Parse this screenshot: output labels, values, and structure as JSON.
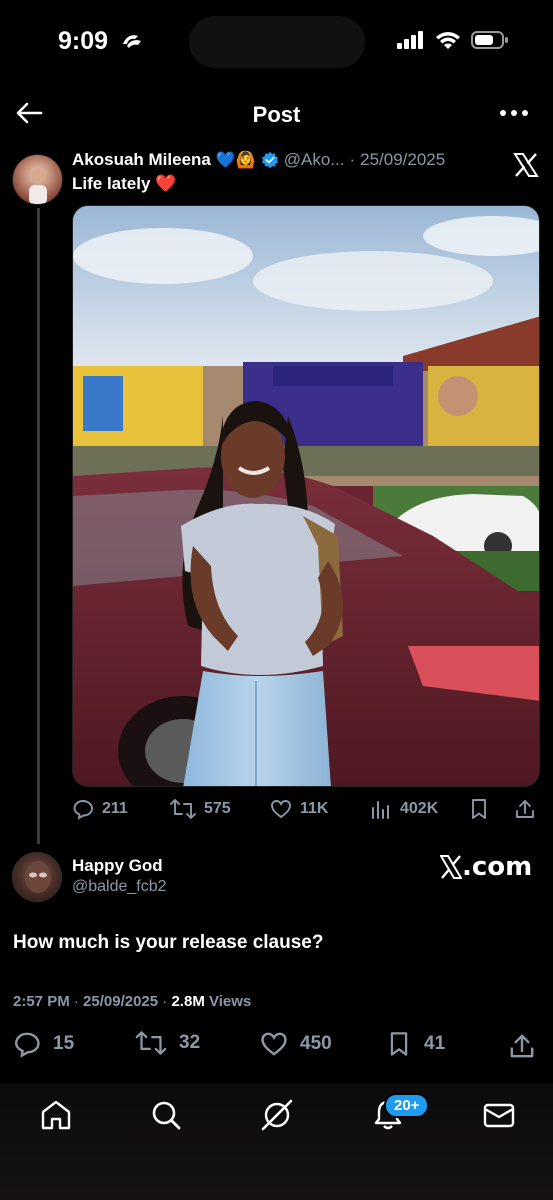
{
  "status_bar": {
    "time": "9:09"
  },
  "header": {
    "title": "Post"
  },
  "quoted_post": {
    "author_name": "Akosuah Mileena",
    "name_emojis": "💙🙆",
    "handle": "@Ako...",
    "separator": "·",
    "date": "25/09/2025",
    "text": "Life lately ❤️",
    "stats": {
      "replies": "211",
      "reposts": "575",
      "likes": "11K",
      "views": "402K"
    }
  },
  "reply_post": {
    "author_name": "Happy God",
    "handle": "@balde_fcb2",
    "source_watermark": ".com",
    "text": "How much is your release clause?",
    "time": "2:57 PM",
    "date": "25/09/2025",
    "separator": "·",
    "views_count": "2.8M",
    "views_label": "Views",
    "stats": {
      "replies": "15",
      "reposts": "32",
      "likes": "450",
      "bookmarks": "41"
    }
  },
  "tab_bar": {
    "notifications_badge": "20+"
  },
  "colors": {
    "accent": "#1d9bf0",
    "muted": "#8b98a5",
    "background": "#000000"
  },
  "icons": [
    "back-arrow-icon",
    "more-icon",
    "verified-icon",
    "x-logo-icon",
    "reply-icon",
    "repost-icon",
    "like-icon",
    "views-icon",
    "bookmark-icon",
    "share-icon",
    "home-icon",
    "search-icon",
    "grok-icon",
    "bell-icon",
    "mail-icon"
  ]
}
